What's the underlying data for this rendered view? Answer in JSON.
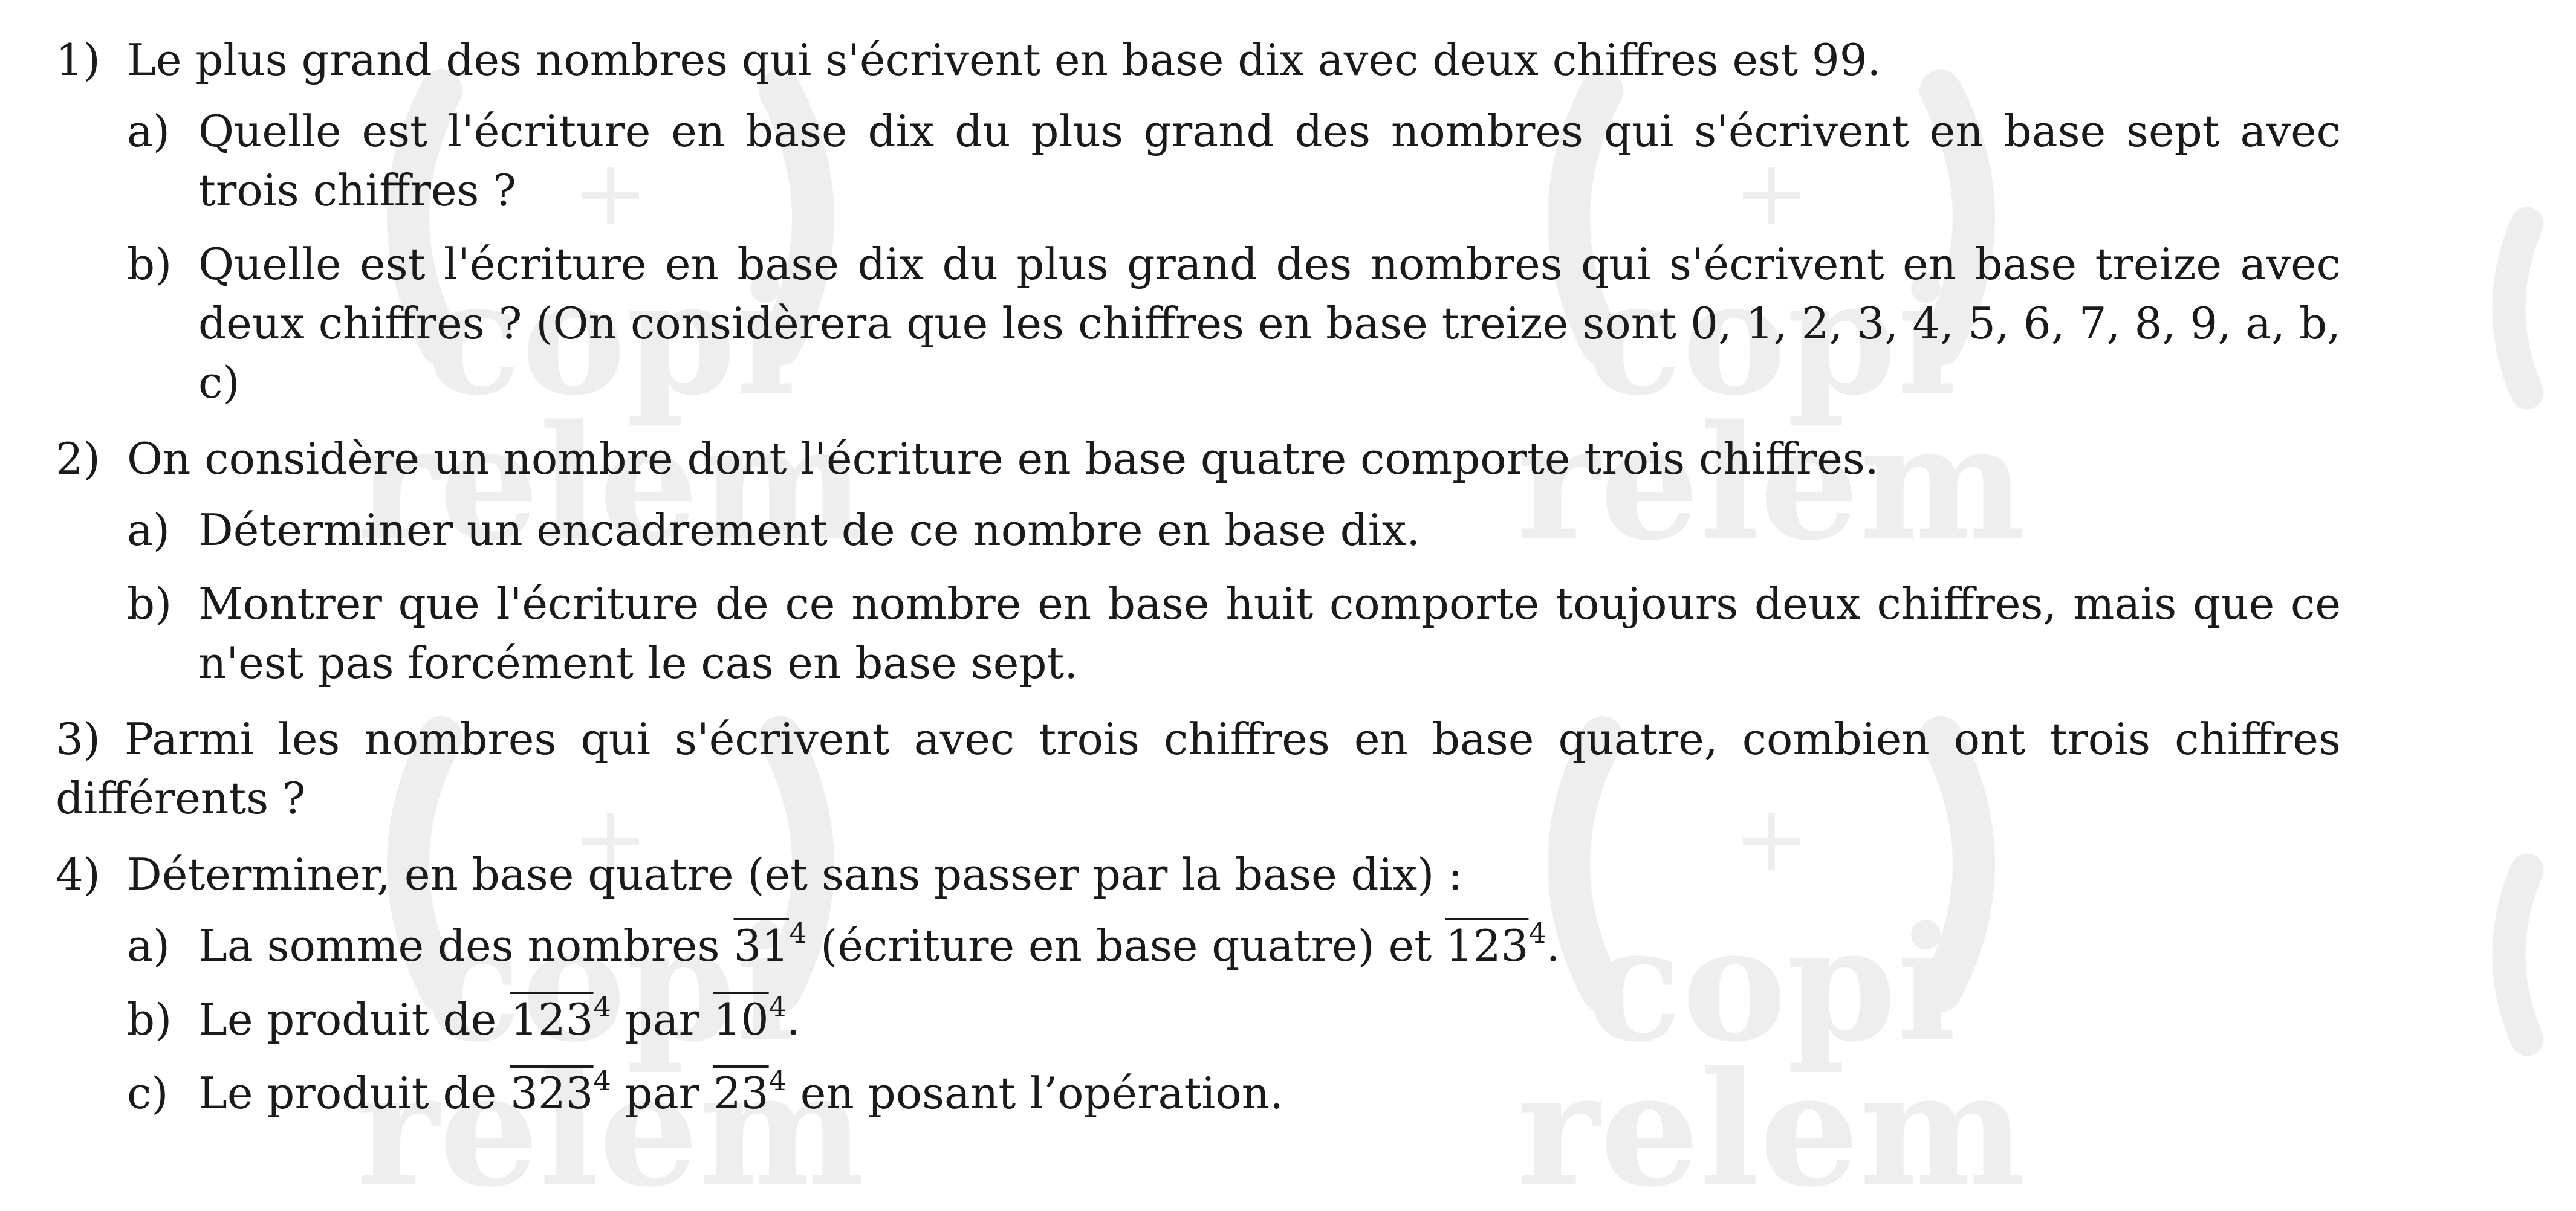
{
  "watermark": {
    "text_top": "copi",
    "text_bottom": "relem",
    "color": "#efefef"
  },
  "q1": {
    "num": "1)",
    "text": "Le plus grand des nombres qui s'écrivent en base dix avec deux chiffres est 99.",
    "a": {
      "num": "a)",
      "text": "Quelle est l'écriture en base dix du plus grand des nombres qui s'écrivent en base sept avec trois chiffres ?"
    },
    "b": {
      "num": "b)",
      "text": "Quelle est l'écriture en base dix du plus grand des nombres qui s'écrivent en base treize avec deux chiffres ? (On considèrera que les chiffres en base treize sont 0, 1, 2, 3, 4, 5, 6, 7, 8, 9, a, b, c)"
    }
  },
  "q2": {
    "num": "2)",
    "text": "On considère un nombre dont l'écriture en base quatre comporte trois chiffres.",
    "a": {
      "num": "a)",
      "text": "Déterminer un encadrement de ce nombre en base dix."
    },
    "b": {
      "num": "b)",
      "text": "Montrer que l'écriture de ce nombre en base huit comporte toujours deux chiffres, mais que ce n'est pas forcément le cas en base sept."
    }
  },
  "q3": {
    "text": "3) Parmi les nombres qui s'écrivent avec trois chiffres en base quatre, combien ont trois chiffres différents ?"
  },
  "q4": {
    "num": "4)",
    "text": "Déterminer, en base quatre (et sans passer par la base dix) :",
    "a": {
      "num": "a)",
      "t1": "La somme des nombres ",
      "n1": "31",
      "b1": "4",
      "t2": " (écriture en base quatre) et ",
      "n2": "123",
      "b2": "4",
      "t3": "."
    },
    "b": {
      "num": "b)",
      "t1": "Le produit de ",
      "n1": "123",
      "b1": "4",
      "t2": " par ",
      "n2": "10",
      "b2": "4",
      "t3": "."
    },
    "c": {
      "num": "c)",
      "t1": "Le produit de ",
      "n1": "323",
      "b1": "4",
      "t2": " par ",
      "n2": "23",
      "b2": "4",
      "t3": " en posant l’opération."
    }
  }
}
